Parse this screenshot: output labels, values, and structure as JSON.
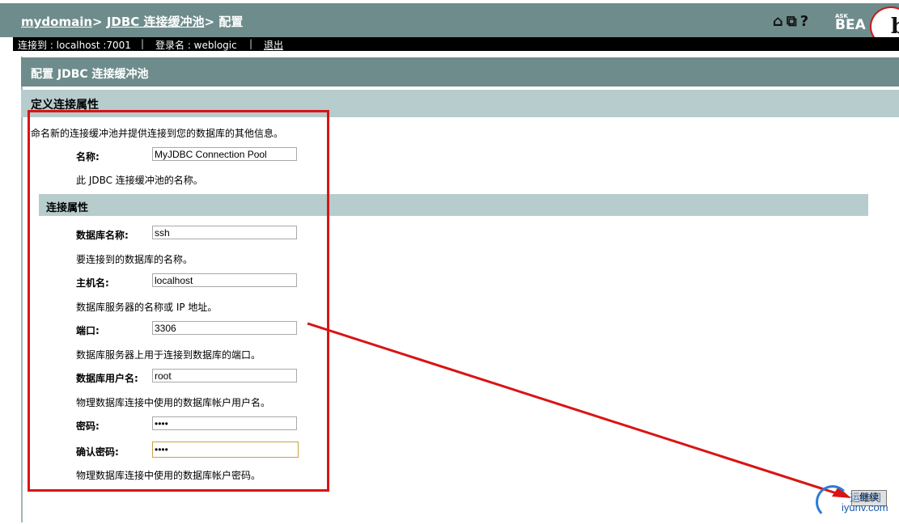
{
  "header": {
    "crumb_domain": "mydomain",
    "crumb_sep1": "> ",
    "crumb_pool": "JDBC 连接缓冲池",
    "crumb_sep2": "> ",
    "crumb_page": "配置",
    "icons": [
      "home-icon",
      "windows-icon",
      "help-icon"
    ],
    "ask_label": "ASK",
    "bea_label": "BEA",
    "logo_letter": "b"
  },
  "status": {
    "connected": "连接到 : localhost :7001",
    "sep": "|",
    "login": "登录名 : weblogic",
    "logout": "退出"
  },
  "panel": {
    "title": "配置 JDBC 连接缓冲池",
    "section": "定义连接属性",
    "intro": "命名新的连接缓冲池并提供连接到您的数据库的其他信息。",
    "subhead": "连接属性"
  },
  "form": {
    "name_label": "名称:",
    "name_value": "MyJDBC Connection Pool",
    "name_help": "此 JDBC 连接缓冲池的名称。",
    "db_label": "数据库名称:",
    "db_value": "ssh",
    "db_help": "要连接到的数据库的名称。",
    "host_label": "主机名:",
    "host_value": "localhost",
    "host_help": "数据库服务器的名称或 IP 地址。",
    "port_label": "端口:",
    "port_value": "3306",
    "port_help": "数据库服务器上用于连接到数据库的端口。",
    "user_label": "数据库用户名:",
    "user_value": "root",
    "user_help": "物理数据库连接中使用的数据库帐户用户名。",
    "pwd_label": "密码:",
    "pwd_value": "••••",
    "pwd_confirm_label": "确认密码:",
    "pwd_confirm_value": "••••",
    "pwd_help": "物理数据库连接中使用的数据库帐户密码。"
  },
  "actions": {
    "next_label": "继续"
  },
  "watermark": {
    "text": "iyunv.com",
    "overlay": "运维网"
  },
  "colors": {
    "header_bg": "#6e8c8c",
    "section_bg": "#b7cccc",
    "annotation": "#d91414"
  }
}
